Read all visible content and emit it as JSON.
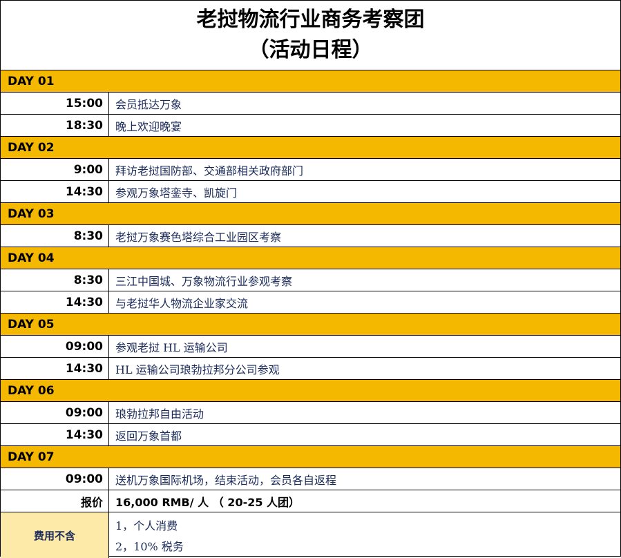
{
  "title": {
    "line1": "老挝物流行业商务考察团",
    "line2": "（活动日程）"
  },
  "days": [
    {
      "label": "DAY 01",
      "items": [
        {
          "time": "15:00",
          "desc": "会员抵达万象"
        },
        {
          "time": "18:30",
          "desc": "晚上欢迎晚宴"
        }
      ]
    },
    {
      "label": "DAY 02",
      "items": [
        {
          "time": "9:00",
          "desc": "拜访老挝国防部、交通部相关政府部门"
        },
        {
          "time": "14:30",
          "desc": "参观万象塔銮寺、凯旋门"
        }
      ]
    },
    {
      "label": "DAY 03",
      "items": [
        {
          "time": "8:30",
          "desc": "老挝万象赛色塔综合工业园区考察"
        }
      ]
    },
    {
      "label": "DAY 04",
      "items": [
        {
          "time": "8:30",
          "desc": "三江中国城、万象物流行业参观考察"
        },
        {
          "time": "14:30",
          "desc": "与老挝华人物流企业家交流"
        }
      ]
    },
    {
      "label": "DAY 05",
      "items": [
        {
          "time": "09:00",
          "desc": "参观老挝 HL 运输公司"
        },
        {
          "time": "14:30",
          "desc": "HL 运输公司琅勃拉邦分公司参观"
        }
      ]
    },
    {
      "label": "DAY 06",
      "items": [
        {
          "time": "09:00",
          "desc": "琅勃拉邦自由活动"
        },
        {
          "time": "14:30",
          "desc": "返回万象首都"
        }
      ]
    },
    {
      "label": "DAY 07",
      "items": [
        {
          "time": "09:00",
          "desc": "送机万象国际机场，结束活动，会员各自返程"
        }
      ]
    }
  ],
  "price": {
    "label": "报价",
    "value": "16,000 RMB/ 人 （ 20-25 人团）"
  },
  "exclusions": {
    "label": "费用不含",
    "items": [
      "1，个人消费",
      "2，10% 税务"
    ]
  },
  "colors": {
    "day_header": "#f5b800",
    "exclusion_label_bg": "#fde9a8"
  }
}
